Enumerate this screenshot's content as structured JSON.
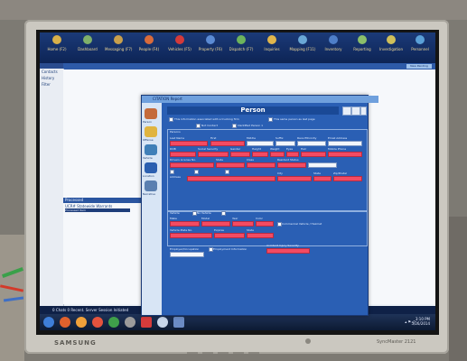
{
  "monitor": {
    "brand": "SAMSUNG",
    "model": "SyncMaster 2121"
  },
  "toolbar": {
    "items": [
      {
        "label": "Home (F2)",
        "icon": "home-icon",
        "color": "#d8b04a"
      },
      {
        "label": "Dashboard",
        "icon": "dashboard-icon",
        "color": "#7fb06a"
      },
      {
        "label": "Messaging (F7)",
        "icon": "messaging-icon",
        "color": "#c9a04c"
      },
      {
        "label": "People (F4)",
        "icon": "people-icon",
        "color": "#d96b3b"
      },
      {
        "label": "Vehicles (F5)",
        "icon": "vehicles-icon",
        "color": "#d43a3a"
      },
      {
        "label": "Property (F6)",
        "icon": "property-icon",
        "color": "#5b8bd4"
      },
      {
        "label": "Dispatch (F7)",
        "icon": "dispatch-icon",
        "color": "#6db45c"
      },
      {
        "label": "Inquiries",
        "icon": "inquiries-icon",
        "color": "#e0b64c"
      },
      {
        "label": "Mapping (F11)",
        "icon": "mapping-icon",
        "color": "#6aa8d6"
      },
      {
        "label": "Inventory",
        "icon": "inventory-icon",
        "color": "#4f7fc8"
      },
      {
        "label": "Reporting",
        "icon": "reporting-icon",
        "color": "#8cc06a"
      },
      {
        "label": "Investigation",
        "icon": "investigation-icon",
        "color": "#d0c05a"
      },
      {
        "label": "Personnel",
        "icon": "personnel-icon",
        "color": "#5aa0d8"
      }
    ]
  },
  "sidebar": {
    "items": [
      "Contacts",
      "History",
      "Filter"
    ]
  },
  "pending": {
    "label": "Pending",
    "new_button": "New Pending"
  },
  "processed": {
    "label": "Processed",
    "item": "UCR# Statewide Warrants",
    "selected": "Processed Item"
  },
  "status_bar": {
    "text": "0 Chats 0 Recent. Server Session Initiated"
  },
  "clock": {
    "time": "3:10 PM",
    "date": "5/26/2014"
  },
  "dialog": {
    "title": "CITATION Report",
    "heading": "Person",
    "nav": [
      "Person",
      "Offense",
      "Vehicle",
      "Location",
      "Narrative"
    ],
    "checks": {
      "top1": "This information associated with a trucking firm",
      "top2": "This same person as last page",
      "c1": "Not Contact",
      "c2": "Identified Person 1"
    },
    "sections": {
      "persons": "Persons",
      "vehicle": "Vehicle",
      "employer": "Employer/Occupation"
    },
    "labels": {
      "last_name": "Last Name",
      "first": "First",
      "middle": "Middle",
      "suffix": "Suffix",
      "race_ethnicity": "Race Ethnicity",
      "email": "Email Address",
      "dob": "DOB",
      "ssn": "Social Security",
      "gender": "Gender",
      "height": "Height",
      "weight": "Weight",
      "eyes": "Eyes",
      "hair": "Hair",
      "mobile": "Mobile Phone",
      "dl_number": "Drivers License No.",
      "state": "State",
      "dl_class": "Class",
      "resident": "Resident Status",
      "address": "Address",
      "city": "City",
      "zip": "Zip/Postal",
      "vehicle_no": "No Vehicle",
      "make": "Make",
      "model": "Model",
      "year": "Year",
      "color": "Color",
      "plate": "Vehicle Plate No.",
      "expires": "Expires",
      "vstate": "State",
      "commercial": "Commercial Vehicle / Hazmat",
      "emp_status": "Employment Information",
      "occupation": "Occupation",
      "accident": "Accident Injury Severity"
    }
  }
}
